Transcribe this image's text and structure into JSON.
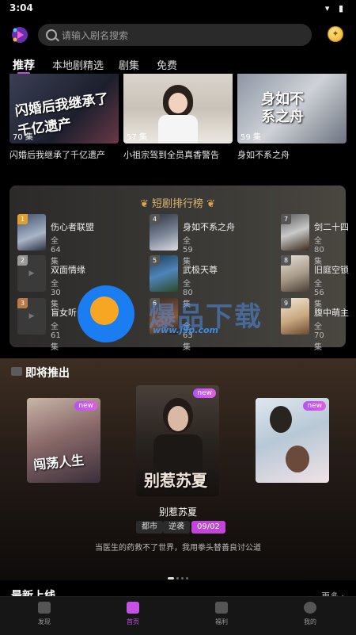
{
  "status": {
    "time": "3:04",
    "icons": "▾ ▮"
  },
  "search": {
    "placeholder": "请输入剧名搜索"
  },
  "coin_icon": "coin-icon",
  "tabs": [
    {
      "label": "推荐",
      "active": true
    },
    {
      "label": "本地剧精选"
    },
    {
      "label": "剧集"
    },
    {
      "label": "免费"
    }
  ],
  "top_cards": [
    {
      "episodes": "70 集",
      "title": "闪婚后我继承了千亿遗产",
      "art": "闪婚后我继承了千亿遗产"
    },
    {
      "episodes": "57 集",
      "title": "小祖宗驾到全员真香警告"
    },
    {
      "episodes": "59 集",
      "title": "身如不系之舟",
      "art": "身如不系之舟"
    }
  ],
  "ranking": {
    "title": "短剧排行榜",
    "items": [
      {
        "rank": "1",
        "name": "伤心者联盟",
        "count": "全64集"
      },
      {
        "rank": "4",
        "name": "身如不系之舟",
        "count": "全59集"
      },
      {
        "rank": "7",
        "name": "剑二十四",
        "count": "全80集"
      },
      {
        "rank": "2",
        "name": "双面情缘",
        "count": "全30集"
      },
      {
        "rank": "5",
        "name": "武极天尊",
        "count": "全80集"
      },
      {
        "rank": "8",
        "name": "旧庭空锁",
        "count": "全56集"
      },
      {
        "rank": "3",
        "name": "盲女听",
        "count": "全61集"
      },
      {
        "rank": "6",
        "name": "",
        "count": "全63集"
      },
      {
        "rank": "9",
        "name": "腹中萌主",
        "count": "全70集"
      }
    ]
  },
  "watermark": {
    "text": "爆品下载",
    "url": "www.j9p.com"
  },
  "coming": {
    "title": "即将推出",
    "new_label": "new",
    "posters": [
      {
        "art": "闯荡人生"
      },
      {
        "art": "别惹苏夏"
      },
      {
        "art": ""
      }
    ],
    "featured": {
      "name": "别惹苏夏",
      "tags": [
        "都市",
        "逆袭"
      ],
      "date": "09/02",
      "desc": "当医生的药救不了世界，我用拳头替善良讨公道"
    }
  },
  "latest": {
    "title": "最新上线",
    "more": "更多 ›"
  },
  "nav": [
    {
      "label": "发现",
      "icon": "discover-icon"
    },
    {
      "label": "首页",
      "icon": "home-icon",
      "active": true
    },
    {
      "label": "福利",
      "icon": "gift-icon"
    },
    {
      "label": "我的",
      "icon": "profile-icon"
    }
  ]
}
